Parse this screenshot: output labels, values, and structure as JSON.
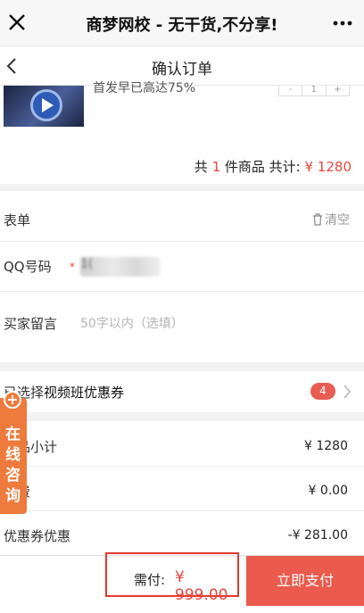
{
  "titlebar": {
    "title": "商梦网校 - 无干货,不分享!"
  },
  "navbar": {
    "title": "确认订单"
  },
  "product": {
    "title_partial": "首发早已高达75%",
    "stepper": {
      "minus": "-",
      "qty": "1",
      "plus": "+"
    },
    "summary": {
      "prefix": "共",
      "count": "1",
      "middle": "件商品 共计:",
      "total": "¥ 1280"
    }
  },
  "form": {
    "section_label": "表单",
    "clear_label": "清空",
    "qq_label": "QQ号码",
    "qq_required": "*",
    "qq_value": "1(",
    "message_label": "买家留言",
    "message_placeholder": "50字以内（选填）"
  },
  "coupon": {
    "prefix": "已选择",
    "name": "视频班优惠券",
    "count": "4"
  },
  "totals": {
    "subtotal_label": "商品小计",
    "subtotal_value": "¥ 1280",
    "shipping_label": "运费",
    "shipping_value": "¥ 0.00",
    "coupon_label": "优惠券优惠",
    "coupon_value": "-¥ 281.00"
  },
  "consult": {
    "label": "在线咨询"
  },
  "footer": {
    "pay_label": "需付:",
    "pay_amount": "¥ 999.00",
    "pay_button": "立即支付"
  },
  "colors": {
    "accent": "#e5473e",
    "consult": "#ee7a3c",
    "button": "#ea5a4d"
  },
  "icons": [
    "close-icon",
    "more-icon",
    "back-icon",
    "trash-icon",
    "chevron-right-icon",
    "plus-circle-icon",
    "play-icon"
  ]
}
